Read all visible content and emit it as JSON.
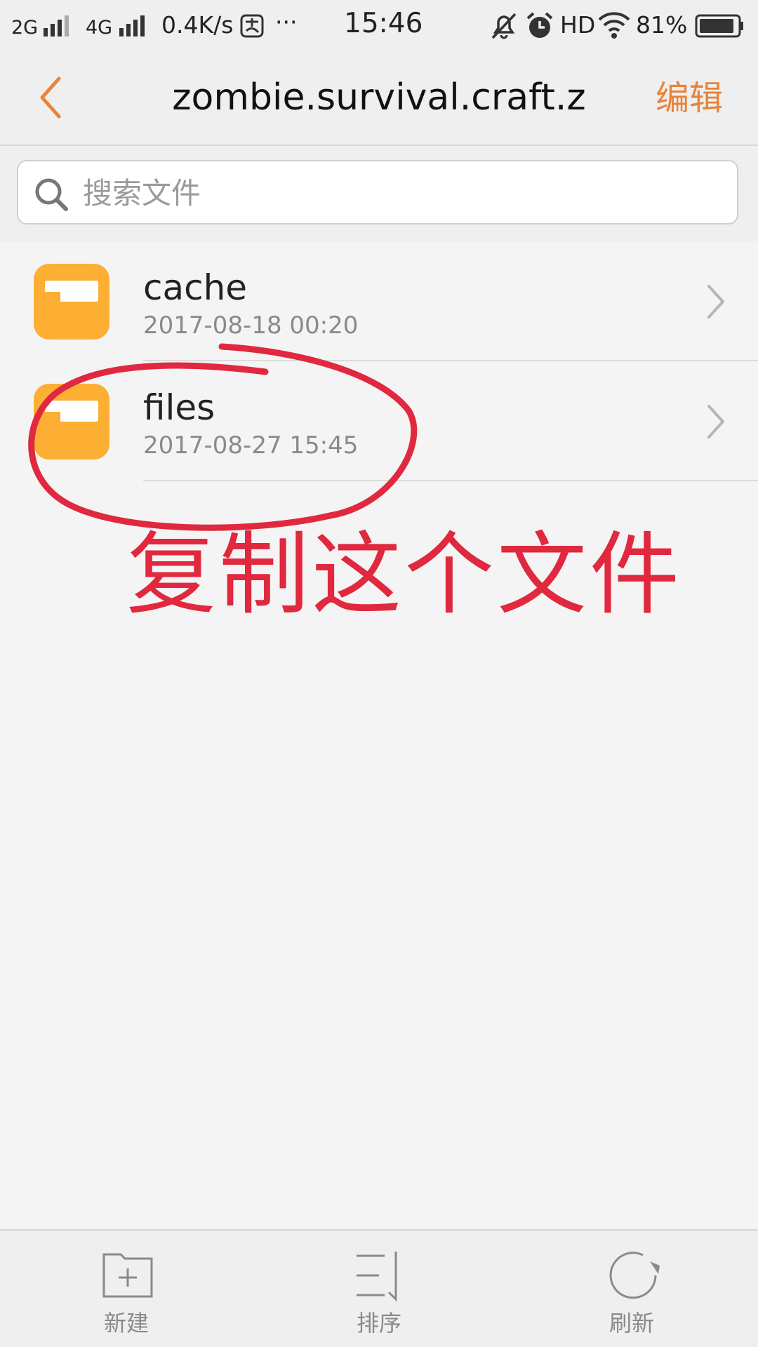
{
  "status_bar": {
    "net1": "2G",
    "net2": "4G",
    "speed": "0.4K/s",
    "dots": "···",
    "time": "15:46",
    "hd": "HD",
    "battery": "81%"
  },
  "header": {
    "title": "zombie.survival.craft.z",
    "edit_label": "编辑"
  },
  "search": {
    "placeholder": "搜索文件"
  },
  "files": [
    {
      "name": "cache",
      "date": "2017-08-18 00:20"
    },
    {
      "name": "files",
      "date": "2017-08-27 15:45"
    }
  ],
  "annotation": {
    "text": "复制这个文件",
    "color": "#e0283f"
  },
  "toolbar": {
    "new_label": "新建",
    "sort_label": "排序",
    "refresh_label": "刷新"
  },
  "colors": {
    "accent": "#e8833a",
    "folder": "#fcaf33"
  }
}
